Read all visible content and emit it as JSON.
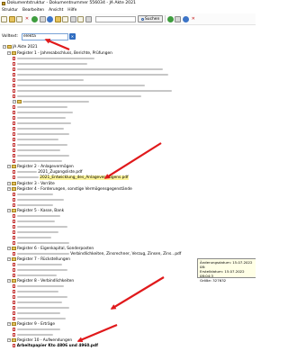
{
  "window": {
    "title": "Dokumentstruktur - Dokumentnummer 556034 - JA Akte 2021"
  },
  "menu": [
    "Struktur",
    "Bearbeiten",
    "Ansicht",
    "Hilfe"
  ],
  "toolbar": {
    "icons": [
      "new-document-icon",
      "open-folder-icon",
      "add-icon",
      "delete-icon",
      "refresh-icon",
      "collapse-icon",
      "expand-icon",
      "move-up-icon",
      "move-down-icon",
      "properties-icon",
      "scan-icon",
      "print-icon"
    ],
    "search_button": "Suchen",
    "tail_icons": [
      "info-icon",
      "settings-icon",
      "help-icon",
      "stop-icon"
    ]
  },
  "search": {
    "label": "Volltext:",
    "value": "elekta"
  },
  "tree": {
    "root": "JA Akte 2021",
    "register1": "Register 1 - Jahresabschluss, Berichte, Prüfungen",
    "register2": "Register 2 - Anlagevermögen",
    "doc_zugang": "2021_Zugangsliste.pdf",
    "doc_entwicklung": "2021_Entwicklung_des_Anlagevermögens.pdf",
    "register3": "Register 3 - Vorräte",
    "register4": "Register 4 - Forderungen, sonstige Vermögensgegenstände",
    "register5": "Register 5 - Kasse, Bank",
    "register6": "Register 6 - Eigenkapital, Sonderposten",
    "register7": "Register 7 - Rückstellungen",
    "register8": "Register 8 - Verbindlichkeiten",
    "register9": "Register 9 - Erträge",
    "register10": "Register 10 - Aufwendungen",
    "row_verbindlichkeiten": "Verbindlichkeiten, Zinsrechner, Verzug, Zinsen, Zins...pdf",
    "doc_arbeitspapier": "Arbeitspapier Kto 4806 und 4960.pdf"
  },
  "tooltip": {
    "line1": "Änderungsdatum: 15.07.2022 08:",
    "line2": "Erstelldatum: 15.07.2022 08:04:3",
    "line3": "Größe: 327632"
  }
}
